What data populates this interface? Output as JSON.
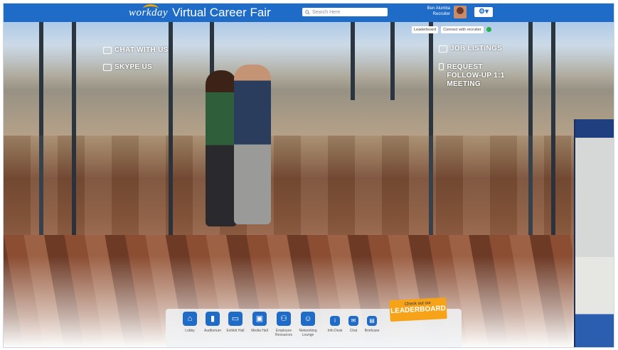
{
  "header": {
    "logo_text": "workday",
    "title": "Virtual Career Fair",
    "search_placeholder": "Search Here",
    "user_name": "Ben Alumba",
    "user_role": "Recruiter",
    "settings_icon": "gear-icon"
  },
  "scene": {
    "hotspots": [
      {
        "label": "CHAT WITH US",
        "icon": "chat-icon"
      },
      {
        "label": "SKYPE US",
        "icon": "skype-icon"
      },
      {
        "label": "JOB LISTINGS",
        "icon": "briefcase-icon"
      },
      {
        "label": "REQUEST FOLLOW-UP 1:1 MEETING",
        "icon": "handshake-icon"
      }
    ],
    "chips": [
      "Leaderboard",
      "Connect with recruiter"
    ]
  },
  "leaderboard": {
    "line1": "Check out our",
    "line2": "LEADERBOARD"
  },
  "dock": [
    {
      "label": "Lobby",
      "icon": "lobby-icon"
    },
    {
      "label": "Auditorium",
      "icon": "auditorium-icon"
    },
    {
      "label": "Exhibit Hall",
      "icon": "exhibit-hall-icon"
    },
    {
      "label": "Media Hall",
      "icon": "media-hall-icon"
    },
    {
      "label": "Employee Resources",
      "icon": "resources-icon"
    },
    {
      "label": "Networking Lounge",
      "icon": "networking-icon"
    },
    {
      "label": "Info Desk",
      "icon": "info-icon"
    },
    {
      "label": "Chat",
      "icon": "chat-icon"
    },
    {
      "label": "Briefcase",
      "icon": "briefcase-icon"
    }
  ]
}
